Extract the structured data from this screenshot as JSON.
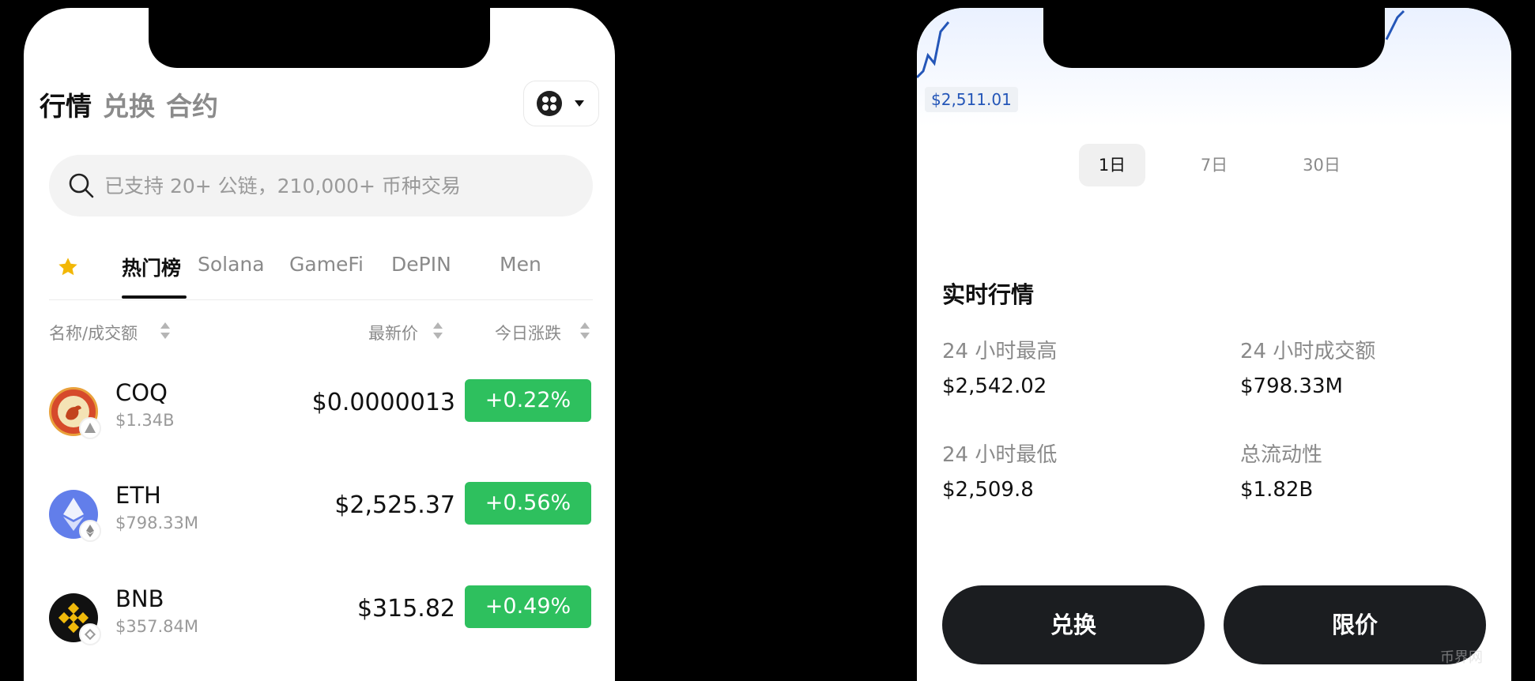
{
  "left_screen": {
    "top_tabs": [
      {
        "label": "行情",
        "active": true
      },
      {
        "label": "兑换",
        "active": false
      },
      {
        "label": "合约",
        "active": false
      }
    ],
    "search": {
      "placeholder": "已支持 20+ 公链，210,000+ 币种交易"
    },
    "categories": [
      "热门榜",
      "Solana",
      "GameFi",
      "DePIN",
      "Men"
    ],
    "active_category": "热门榜",
    "columns": {
      "name": "名称/成交额",
      "price": "最新价",
      "change": "今日涨跌"
    },
    "tokens": [
      {
        "symbol": "COQ",
        "volume": "$1.34B",
        "price": "$0.0000013",
        "change": "+0.22%"
      },
      {
        "symbol": "ETH",
        "volume": "$798.33M",
        "price": "$2,525.37",
        "change": "+0.56%"
      },
      {
        "symbol": "BNB",
        "volume": "$357.84M",
        "price": "$315.82",
        "change": "+0.49%"
      }
    ]
  },
  "right_screen": {
    "chart_price_tag": "$2,511.01",
    "ranges": [
      {
        "label": "1日",
        "active": true
      },
      {
        "label": "7日",
        "active": false
      },
      {
        "label": "30日",
        "active": false
      }
    ],
    "section_title": "实时行情",
    "stats": [
      {
        "label": "24 小时最高",
        "value": "$2,542.02"
      },
      {
        "label": "24 小时成交额",
        "value": "$798.33M"
      },
      {
        "label": "24 小时最低",
        "value": "$2,509.8"
      },
      {
        "label": "总流动性",
        "value": "$1.82B"
      }
    ],
    "buttons": {
      "swap": "兑换",
      "limit": "限价"
    }
  },
  "watermark": "币界网",
  "colors": {
    "up_green": "#2ec05e",
    "button_dark": "#1b1d20",
    "accent_blue": "#2456b8",
    "star_yellow": "#f2b705"
  }
}
